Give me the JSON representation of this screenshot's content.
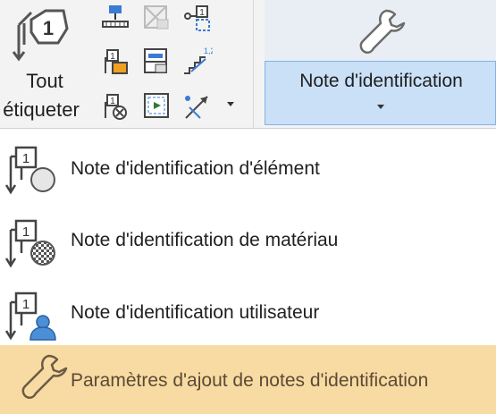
{
  "ribbon": {
    "tag_all": {
      "line1": "Tout",
      "line2": "étiqueter"
    },
    "small_tools": [
      "multi-category-tag-icon",
      "area-tag-icon-disabled",
      "keynote-settings-icon",
      "material-tag-icon",
      "room-tag-icon",
      "stair-path-tag-icon",
      "tag-not-tagged-icon",
      "beam-annotation-icon",
      "span-direction-icon"
    ],
    "keynote": {
      "label": "Note d'identification",
      "icon": "wrench-icon"
    }
  },
  "menu": {
    "items": [
      {
        "label": "Note d'identification d'élément",
        "icon": "element-keynote-icon"
      },
      {
        "label": "Note d'identification de matériau",
        "icon": "material-keynote-icon"
      },
      {
        "label": "Note d'identification utilisateur",
        "icon": "user-keynote-icon"
      },
      {
        "label": "Paramètres d'ajout de notes d'identification",
        "icon": "wrench-icon",
        "highlighted": true
      }
    ]
  },
  "colors": {
    "ribbon_bg": "#f3f3f3",
    "selected_button": "#c9e0f7",
    "selected_border": "#7eb4ea",
    "menu_highlight": "#f8dba2"
  }
}
